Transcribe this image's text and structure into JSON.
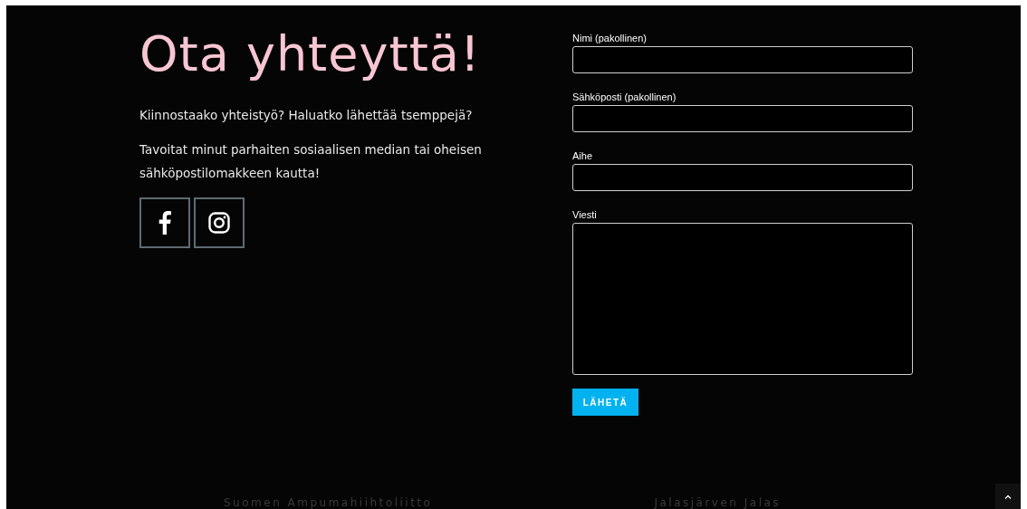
{
  "heading": "Ota yhteyttä!",
  "paragraphs": [
    "Kiinnostaako yhteistyö? Haluatko lähettää tsemppejä?",
    "Tavoitat minut parhaiten sosiaalisen median tai oheisen sähköpostilomakkeen kautta!"
  ],
  "social_links": [
    {
      "kind": "facebook"
    },
    {
      "kind": "instagram"
    }
  ],
  "form": {
    "fields": [
      {
        "label": "Nimi (pakollinen)",
        "kind": "text"
      },
      {
        "label": "Sähköposti (pakollinen)",
        "kind": "text"
      },
      {
        "label": "Aihe",
        "kind": "text"
      },
      {
        "label": "Viesti",
        "kind": "textarea"
      }
    ],
    "submit": "LÄHETÄ"
  },
  "footer_links": [
    "Suomen Ampumahiihtoliitto",
    "Jalasjärven Jalas"
  ]
}
